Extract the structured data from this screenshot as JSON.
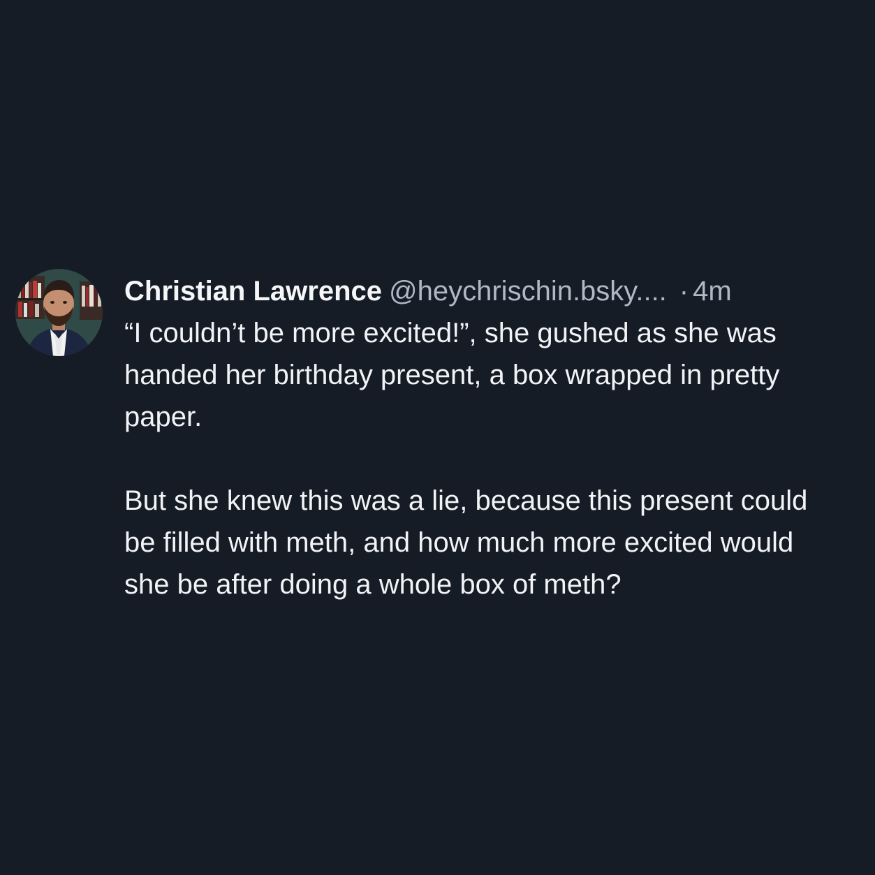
{
  "post": {
    "author_name": "Christian Lawrence",
    "author_handle": "@heychrischin.bsky....",
    "separator": "·",
    "timestamp": "4m",
    "avatar_icon": "profile-photo-icon",
    "paragraphs": [
      "“I couldn’t be more excited!”, she gushed as she was handed her birthday present, a box wrapped in pretty paper.",
      "But she knew this was a lie, because this present could be filled with meth, and how much more excited would she be after doing a whole box of meth?"
    ]
  },
  "colors": {
    "background": "#161c26",
    "text_primary": "#f1f3f6",
    "text_secondary": "#aeb8c6"
  }
}
